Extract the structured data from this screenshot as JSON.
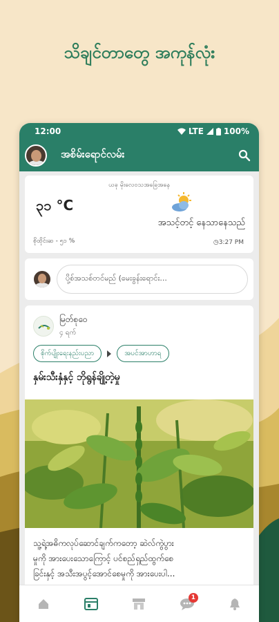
{
  "promo": {
    "title": "သိချင်တာတွေ အကုန်လုံး"
  },
  "status_bar": {
    "time": "12:00",
    "network": "LTE",
    "battery": "100%"
  },
  "app_bar": {
    "title": "အစိမ်းရောင်လမ်း",
    "search_icon": "search-icon"
  },
  "weather": {
    "location": "ယခု မိုးလေဝသအခြေအနေ",
    "temperature": "၃၁ °C",
    "description": "အသင့်တင့် နေသာနေသည်",
    "humidity": "စိုထိုင်းဆ - ၅၁ %",
    "updated_time": "3:27 PM",
    "icon": "partly-cloudy-icon"
  },
  "composer": {
    "placeholder": "ပို့စ်အသစ်တင်မည် (မေးခွန်းရောင်း..."
  },
  "post": {
    "author": "မြတ်စုဝေ",
    "time": "၄ ရက်",
    "tags": [
      "စိုက်ပျိုးရေးနည်းပညာ",
      "အပင်အာဟာရ"
    ],
    "title": "နှမ်းသီးနှံနှင့် ဘိုရွန်ချို့တဲ့မှု",
    "body_line1": "သူ့ရဲ့အဓိကလုပ်ဆောင်ချက်ကတော့ ဆဲလ်ကွဲပွား",
    "body_line2": "မှုကို အားပေးသောကြောင့် ပင်စည်ရှည်ထွက်စေ",
    "body_line3": "ခြင်းနှင့် အသီးအပွင့်အောင်စေမှုကို အားပေးပါ..."
  },
  "bottom_nav": {
    "items": [
      "home-icon",
      "feed-icon",
      "shop-icon",
      "chat-icon",
      "notification-icon"
    ],
    "chat_badge": "1"
  },
  "colors": {
    "brand": "#2a7f68",
    "background": "#f7e6c8",
    "badge": "#e53935"
  }
}
